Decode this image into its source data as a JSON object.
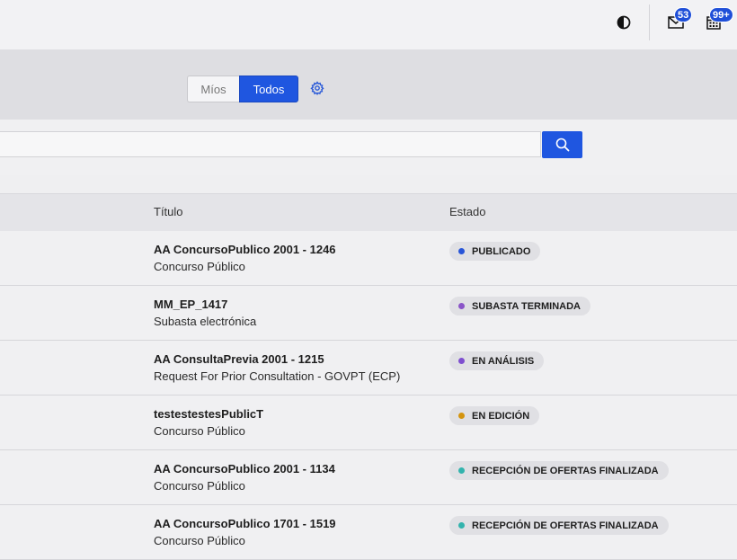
{
  "header": {
    "mail_badge": "53",
    "calendar_badge": "99+"
  },
  "filter": {
    "mine_label": "Míos",
    "all_label": "Todos"
  },
  "search": {
    "placeholder": ""
  },
  "table": {
    "columns": {
      "title": "Título",
      "status": "Estado"
    },
    "rows": [
      {
        "title": "AA ConcursoPublico 2001 - 1246",
        "subtitle": "Concurso Público",
        "status": "PUBLICADO",
        "status_color": "#2855d8"
      },
      {
        "title": "MM_EP_1417",
        "subtitle": "Subasta electrónica",
        "status": "SUBASTA TERMINADA",
        "status_color": "#8a55c8"
      },
      {
        "title": "AA ConsultaPrevia 2001 - 1215",
        "subtitle": "Request For Prior Consultation - GOVPT (ECP)",
        "status": "EN ANÁLISIS",
        "status_color": "#7e4fcf"
      },
      {
        "title": "testestestesPublicT",
        "subtitle": "Concurso Público",
        "status": "EN EDICIÓN",
        "status_color": "#d4940e"
      },
      {
        "title": "AA ConcursoPublico 2001 - 1134",
        "subtitle": "Concurso Público",
        "status": "RECEPCIÓN DE OFERTAS FINALIZADA",
        "status_color": "#33b3ad"
      },
      {
        "title": "AA ConcursoPublico 1701 - 1519",
        "subtitle": "Concurso Público",
        "status": "RECEPCIÓN DE OFERTAS FINALIZADA",
        "status_color": "#33b3ad"
      }
    ]
  },
  "icons": {
    "theme": "contrast-icon",
    "mail": "mail-icon",
    "calendar": "calendar-icon",
    "settings": "gear-icon",
    "search": "search-icon"
  }
}
